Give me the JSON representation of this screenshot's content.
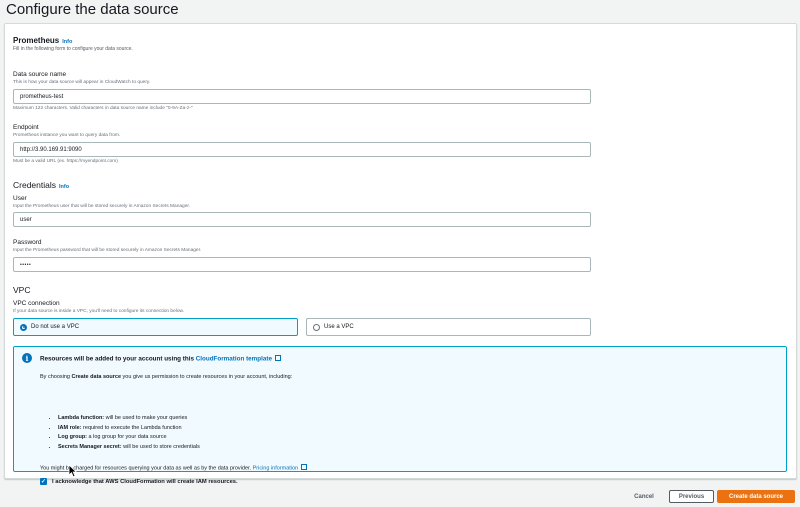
{
  "page": {
    "title": "Configure the data source"
  },
  "prometheus": {
    "heading": "Prometheus",
    "info": "Info",
    "description": "Fill in the following form to configure your data source."
  },
  "fields": {
    "name": {
      "label": "Data source name",
      "description": "This is how your data source will appear in CloudWatch to query.",
      "value": "prometheus-test",
      "constraint": "Maximum 122 characters. Valid characters in data source name include \"0-9A-Za-z-\""
    },
    "endpoint": {
      "label": "Endpoint",
      "description": "Prometheus instance you want to query data from.",
      "value": "http://3.90.169.91:9090",
      "constraint": "Must be a valid URL (ex. https://myendpoint.com)"
    }
  },
  "credentials": {
    "heading": "Credentials",
    "info": "Info",
    "user": {
      "label": "User",
      "description": "Input the Prometheus user that will be stored securely in Amazon Secrets Manager.",
      "value": "user"
    },
    "password": {
      "label": "Password",
      "description": "Input the Prometheus password that will be stored securely in Amazon Secrets Manager.",
      "value": "•••••"
    }
  },
  "vpc": {
    "heading": "VPC",
    "label": "VPC connection",
    "description": "If your data source is inside a VPC, you'll need to configure its connection below.",
    "options": [
      {
        "label": "Do not use a VPC",
        "selected": true
      },
      {
        "label": "Use a VPC",
        "selected": false
      }
    ]
  },
  "notice": {
    "title_prefix": "Resources will be added to your account using this ",
    "title_link": "CloudFormation template",
    "intro_prefix": "By choosing ",
    "intro_bold": "Create data source",
    "intro_suffix": " you give us permission to create resources in your account, including:",
    "items": [
      {
        "term": "Lambda function:",
        "text": " will be used to make your queries"
      },
      {
        "term": "IAM role:",
        "text": " required to execute the Lambda function"
      },
      {
        "term": "Log group:",
        "text": " a log group for your data source"
      },
      {
        "term": "Secrets Manager secret:",
        "text": " will be used to store credentials"
      }
    ],
    "charge_text": "You might be charged for resources querying your data as well as by the data provider. ",
    "charge_link": "Pricing information",
    "ack": "I acknowledge that AWS CloudFormation will create IAM resources."
  },
  "footer": {
    "cancel": "Cancel",
    "previous": "Previous",
    "create": "Create data source"
  },
  "colors": {
    "link": "#0073bb",
    "primary": "#ec7211",
    "selected_border": "#00a1c9"
  }
}
